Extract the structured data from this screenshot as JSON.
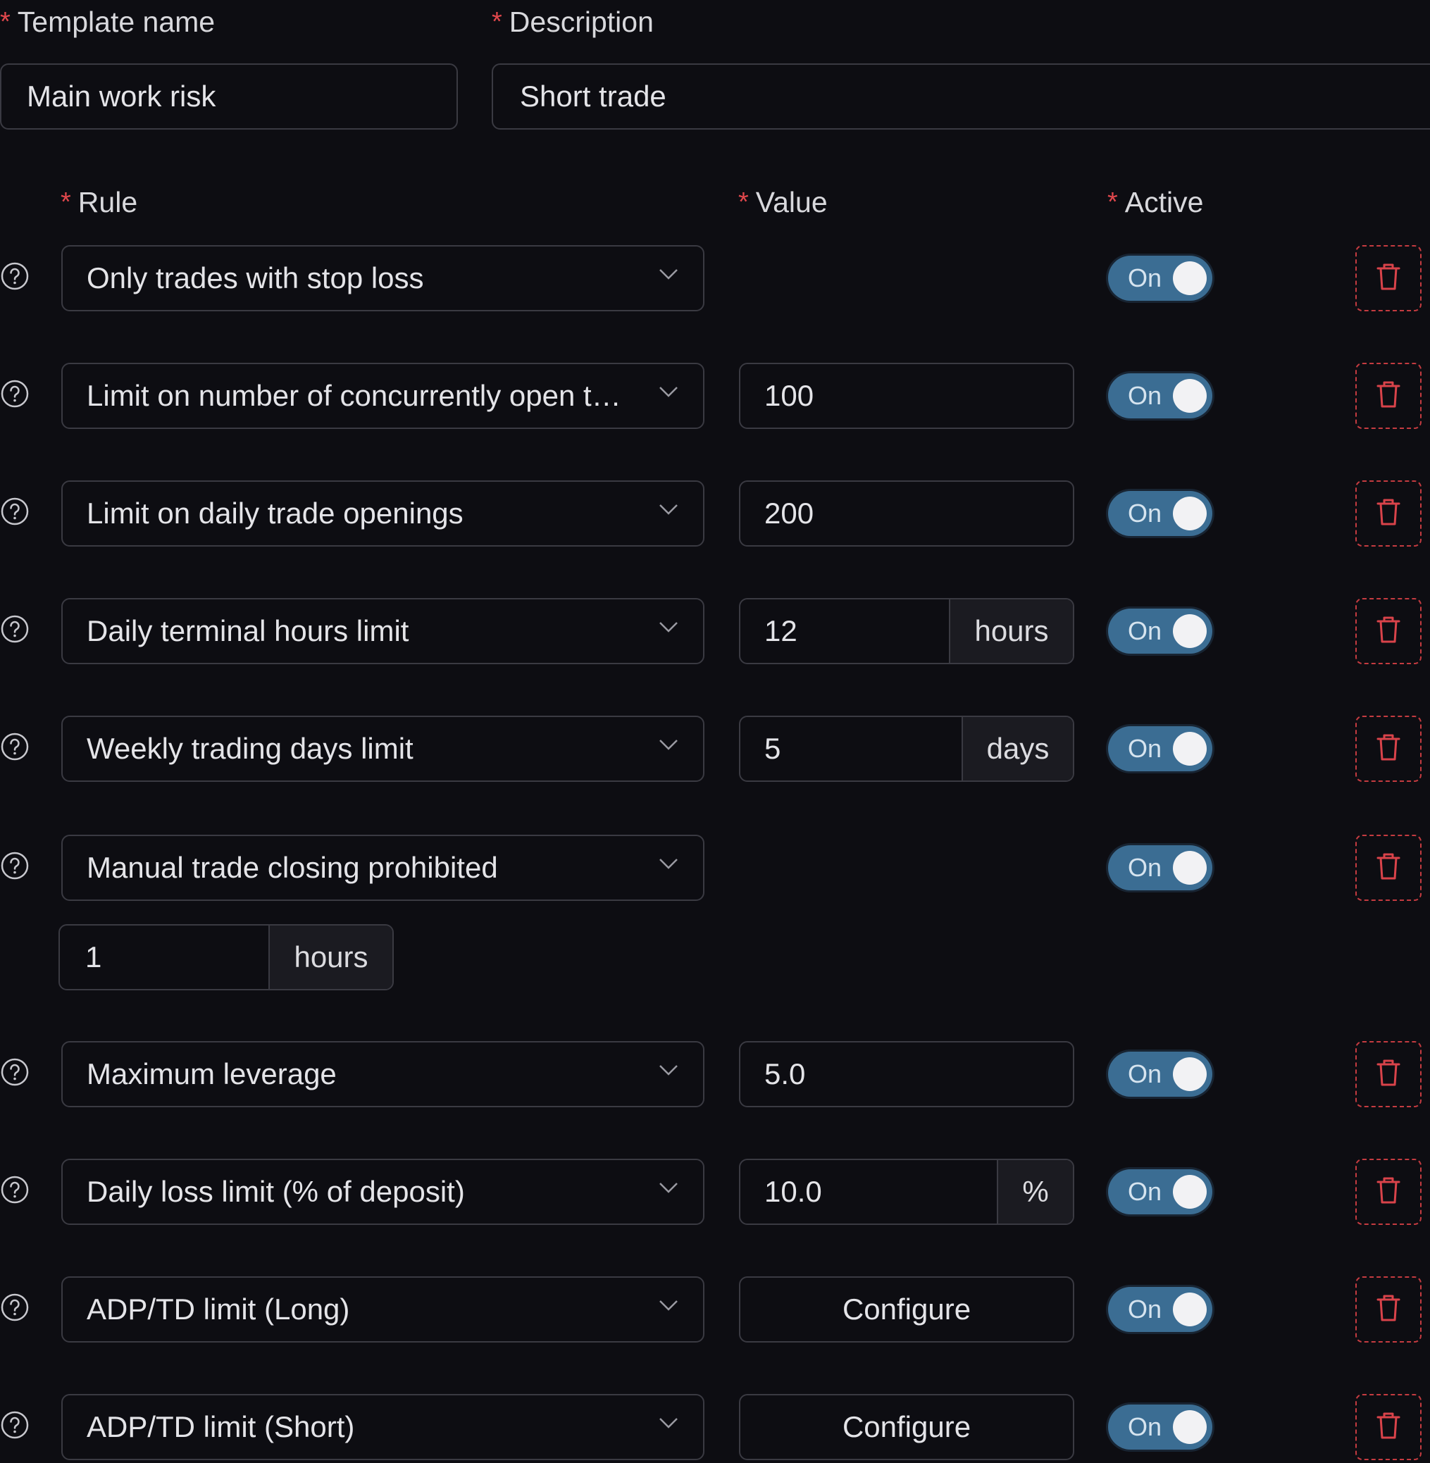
{
  "header": {
    "template_name_label": "Template name",
    "template_name_value": "Main work risk",
    "description_label": "Description",
    "description_value": "Short trade"
  },
  "columns": {
    "rule": "Rule",
    "value": "Value",
    "active": "Active"
  },
  "required_mark": "*",
  "rules": [
    {
      "rule": "Only trades with stop loss",
      "active": "On"
    },
    {
      "rule": "Limit on number of concurrently open tr···",
      "value": "100",
      "active": "On"
    },
    {
      "rule": "Limit on daily trade openings",
      "value": "200",
      "active": "On"
    },
    {
      "rule": "Daily terminal hours limit",
      "value": "12",
      "unit": "hours",
      "active": "On"
    },
    {
      "rule": "Weekly trading days limit",
      "value": "5",
      "unit": "days",
      "active": "On"
    },
    {
      "rule": "Manual trade closing prohibited",
      "active": "On",
      "sub_value": "1",
      "sub_unit": "hours"
    },
    {
      "rule": "Maximum leverage",
      "value": "5.0",
      "active": "On"
    },
    {
      "rule": "Daily loss limit (% of deposit)",
      "value": "10.0",
      "unit": "%",
      "active": "On"
    },
    {
      "rule": "ADP/TD limit (Long)",
      "button": "Configure",
      "active": "On"
    },
    {
      "rule": "ADP/TD limit (Short)",
      "button": "Configure",
      "active": "On"
    }
  ],
  "colors": {
    "accent": "#3b6d93",
    "danger": "#c43b40",
    "background": "#0d0d12",
    "border": "#3a3a42"
  },
  "icons": {
    "help": "help-circle-icon",
    "select": "chevron-down-icon",
    "delete": "trash-icon"
  }
}
